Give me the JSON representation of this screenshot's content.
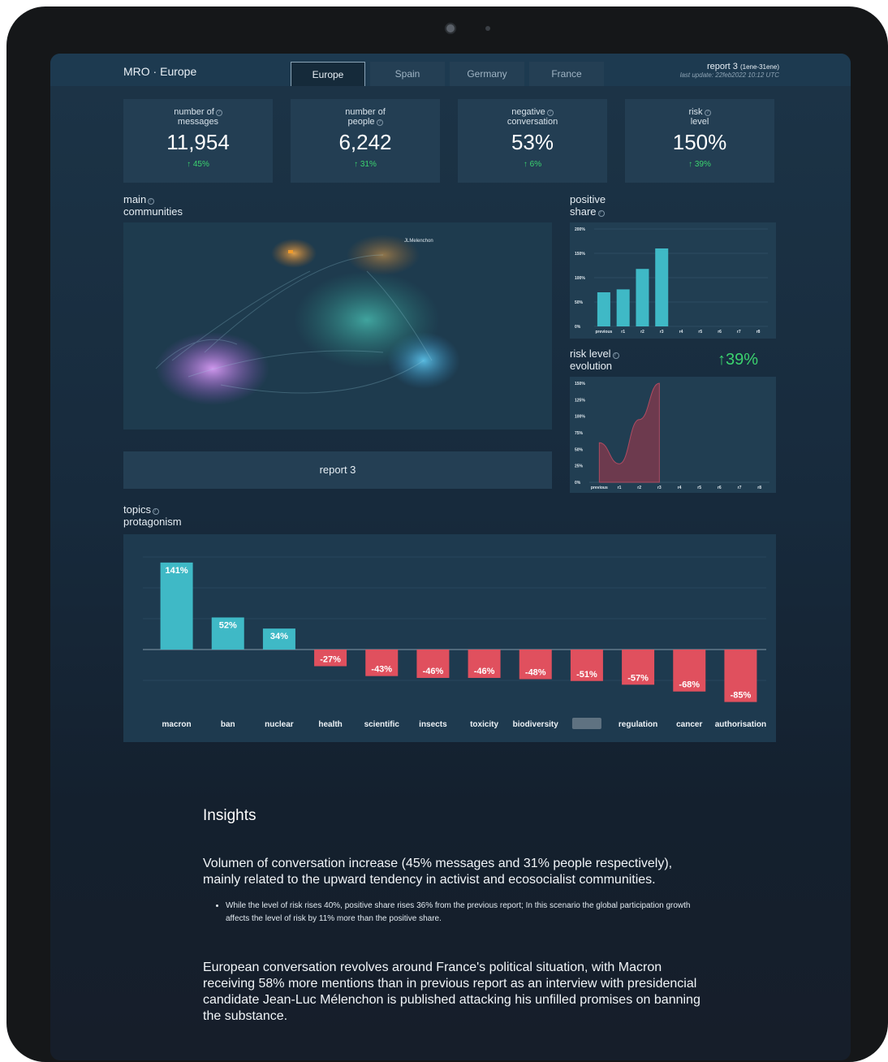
{
  "header": {
    "brand": "MRO · Europe",
    "tabs": [
      "Europe",
      "Spain",
      "Germany",
      "France"
    ],
    "active_tab": "Europe",
    "report_title": "report 3",
    "report_range": "(1ene-31ene)",
    "last_update": "last update: 22feb2022 10:12 UTC"
  },
  "kpis": [
    {
      "label_line1": "number of",
      "label_line2": "messages",
      "value": "11,954",
      "delta": "45%"
    },
    {
      "label_line1": "number of",
      "label_line2": "people",
      "value": "6,242",
      "delta": "31%"
    },
    {
      "label_line1": "negative",
      "label_line2": "conversation",
      "value": "53%",
      "delta": "6%"
    },
    {
      "label_line1": "risk",
      "label_line2": "level",
      "value": "150%",
      "delta": "39%"
    }
  ],
  "sections": {
    "communities_line1": "main",
    "communities_line2": "communities",
    "positive_line1": "positive",
    "positive_line2": "share",
    "risk_line1": "risk level",
    "risk_line2": "evolution",
    "risk_delta": "↑39%",
    "topics_line1": "topics",
    "topics_line2": "protagonism",
    "report_button": "report 3"
  },
  "network_labels": {
    "main": "JLMelenchon"
  },
  "colors": {
    "teal": "#3fb9c6",
    "red": "#e0505e",
    "green": "#3bd36f",
    "purple": "#c07be8",
    "orange": "#e89a3a"
  },
  "chart_data": [
    {
      "type": "bar",
      "title": "positive share",
      "categories": [
        "previous",
        "r1",
        "r2",
        "r3",
        "r4",
        "r5",
        "r6",
        "r7",
        "r8"
      ],
      "values": [
        70,
        76,
        118,
        160,
        null,
        null,
        null,
        null,
        null
      ],
      "ylim": [
        0,
        200
      ],
      "yticks": [
        "0%",
        "50%",
        "100%",
        "150%",
        "200%"
      ]
    },
    {
      "type": "area",
      "title": "risk level evolution",
      "categories": [
        "previous",
        "r1",
        "r2",
        "r3",
        "r4",
        "r5",
        "r6",
        "r7",
        "r8"
      ],
      "values": [
        60,
        28,
        95,
        150,
        null,
        null,
        null,
        null,
        null
      ],
      "ylim": [
        0,
        150
      ],
      "yticks": [
        "0%",
        "25%",
        "50%",
        "75%",
        "100%",
        "125%",
        "150%"
      ]
    },
    {
      "type": "bar",
      "title": "topics protagonism",
      "categories": [
        "macron",
        "ban",
        "nuclear",
        "health",
        "scientific",
        "insects",
        "toxicity",
        "biodiversity",
        "",
        "regulation",
        "cancer",
        "authorisation"
      ],
      "values": [
        141,
        52,
        34,
        -27,
        -43,
        -46,
        -46,
        -48,
        -51,
        -57,
        -68,
        -85
      ],
      "labels": [
        "141%",
        "52%",
        "34%",
        "-27%",
        "-43%",
        "-46%",
        "-46%",
        "-48%",
        "-51%",
        "-57%",
        "-68%",
        "-85%"
      ],
      "ylim": [
        -100,
        150
      ],
      "grid": true
    }
  ],
  "insights": {
    "title": "Insights",
    "p1": "Volumen of conversation increase (45% messages and 31% people respectively), mainly related to the upward tendency in activist and ecosocialist communities.",
    "bullet1": "While the level of risk rises 40%, positive share rises 36% from the previous report; In this scenario the global participation growth affects the level of risk by 11% more than the positive share.",
    "p2": "European conversation revolves around France's political situation, with Macron receiving 58% more mentions than in previous report as an interview with presidencial candidate Jean-Luc Mélenchon is published attacking his unfilled promises on banning the substance."
  }
}
